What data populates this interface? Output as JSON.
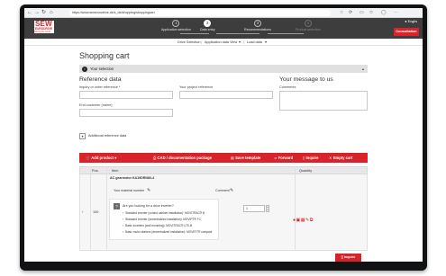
{
  "browser": {
    "url": "https://www.seweurodrive.de/s_de/shopping/shoppingcart",
    "nav_icons": [
      "back-icon",
      "forward-icon",
      "reload-icon",
      "home-icon"
    ],
    "tool_icons": [
      "star-icon",
      "refresh-icon",
      "tabs-icon",
      "favorites-icon",
      "profile-icon",
      "menu-icon"
    ]
  },
  "header": {
    "logo": {
      "line1": "SEW",
      "line2": "EURODRIVE",
      "tagline": "Driving the world"
    },
    "steps": [
      {
        "num": "1",
        "label": "Application selection",
        "state": "done"
      },
      {
        "num": "2",
        "label": "Data entry",
        "state": "active"
      },
      {
        "num": "3",
        "label": "Recommendations",
        "state": "done"
      },
      {
        "num": "4",
        "label": "Product selection",
        "state": "dim"
      }
    ],
    "language": "Englis",
    "consultation": "Consultation"
  },
  "subnav": {
    "items": [
      "Drive Selection",
      "Application data View",
      "Load data"
    ],
    "carets": [
      "▾",
      "▾"
    ]
  },
  "page": {
    "title": "Shopping cart",
    "selection_bar": "Your selection",
    "selection_caret": "▴",
    "reference_heading": "Reference data",
    "message_heading": "Your message to us",
    "fields": {
      "inquiry_label": "Inquiry or order reference *",
      "project_label": "Your project reference",
      "comments_label": "Comments",
      "end_customer_label": "End customer (name)"
    },
    "additional_reference": "Additional reference data",
    "additional_toggle": "▾"
  },
  "toolbar": {
    "add_product": "Add product",
    "cad": "CAD / documentation package",
    "save": "Save template",
    "forward": "Forward",
    "inquire": "Inquire",
    "empty": "Empty cart"
  },
  "table": {
    "headers": {
      "pos": "Pos.",
      "item": "Item",
      "quantity": "Quantity"
    },
    "row": {
      "expand": "›",
      "pos": "100",
      "product": "AC gearmotor KA19DRN80-4",
      "material_label": "Your material number",
      "comment_label": "Comment",
      "question": "Are you looking for a drive inverter?",
      "options": [
        "Standard inverter (control cabinet installation): MOVITRAC® B",
        "Standard inverter (decentralized installation): MOVIPT® FC",
        "Basic inverters (wall mounting): MOVITRAC® LTE-B",
        "Basic motor starters (decentralized installation): MOVIFIT® compact"
      ],
      "quantity": "1"
    }
  },
  "footer": {
    "inquire_button": "Inquire"
  }
}
